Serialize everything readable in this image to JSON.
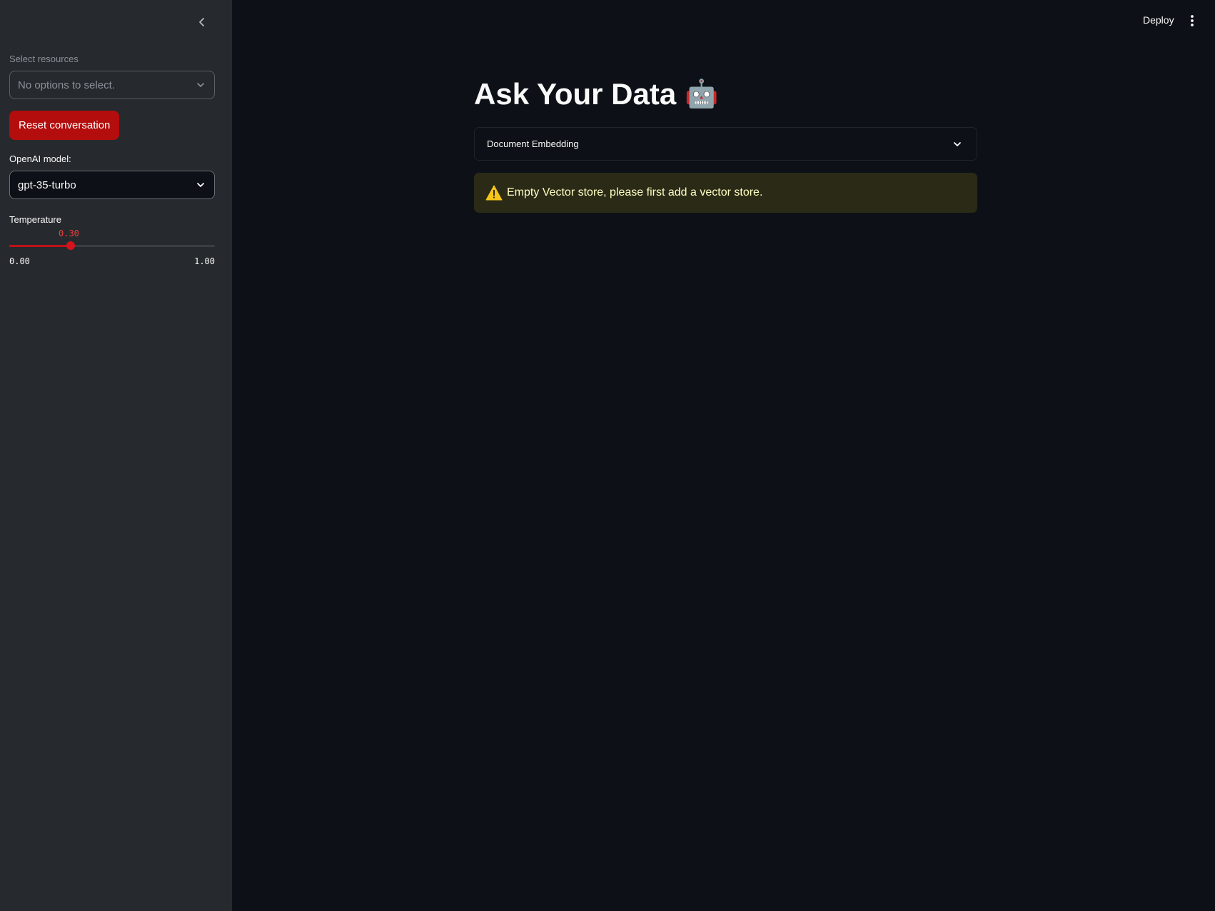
{
  "sidebar": {
    "collapse_icon": "chevron-left-icon",
    "resources": {
      "label": "Select resources",
      "placeholder": "No options to select."
    },
    "reset_button": "Reset conversation",
    "model": {
      "label": "OpenAI model:",
      "value": "gpt-35-turbo"
    },
    "temperature": {
      "label": "Temperature",
      "value": 0.3,
      "value_text": "0.30",
      "min_text": "0.00",
      "max_text": "1.00",
      "min": 0,
      "max": 1
    }
  },
  "header": {
    "deploy_label": "Deploy",
    "menu_icon": "kebab-menu-icon"
  },
  "main": {
    "title": "Ask Your Data",
    "title_emoji": "🤖",
    "expander_label": "Document Embedding",
    "alert": {
      "icon": "⚠️",
      "text": "Empty Vector store, please first add a vector store."
    }
  },
  "colors": {
    "accent": "#b30d0d",
    "sidebar_bg": "#262a2e",
    "main_bg": "#0d1117",
    "warning_bg": "#2b2a17",
    "warning_text": "#ffffc2"
  }
}
